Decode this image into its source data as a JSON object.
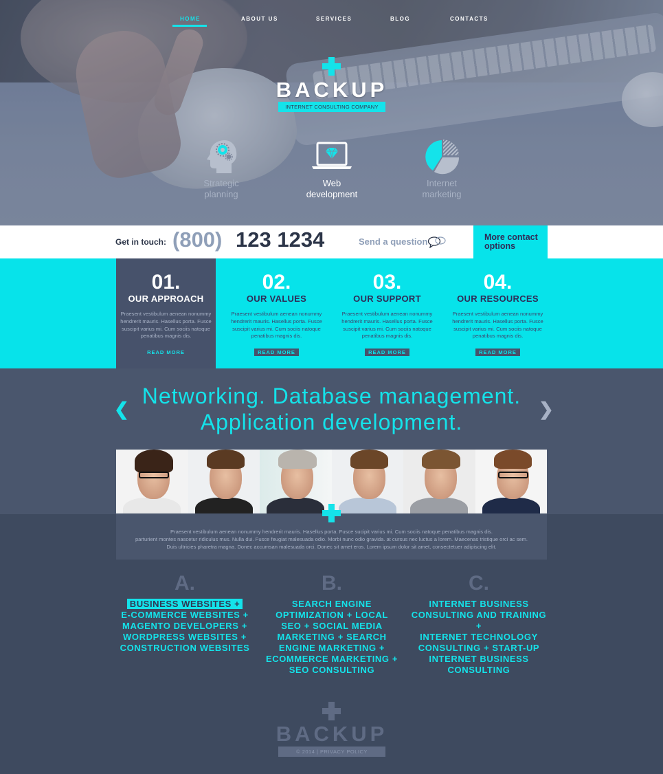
{
  "nav": {
    "items": [
      {
        "label": "HOME",
        "active": true
      },
      {
        "label": "ABOUT US",
        "active": false
      },
      {
        "label": "SERVICES",
        "active": false
      },
      {
        "label": "BLOG",
        "active": false
      },
      {
        "label": "CONTACTS",
        "active": false
      }
    ]
  },
  "brand": {
    "name": "BACKUP",
    "tagline": "INTERNET CONSULTING COMPANY",
    "logo_icon": "plus-icon"
  },
  "hero": {
    "features": [
      {
        "label_line1": "Strategic",
        "label_line2": "planning",
        "icon": "head-gears-icon",
        "active": false
      },
      {
        "label_line1": "Web",
        "label_line2": "development",
        "icon": "laptop-diamond-icon",
        "active": true
      },
      {
        "label_line1": "Internet",
        "label_line2": "marketing",
        "icon": "pie-chart-icon",
        "active": false
      }
    ]
  },
  "contact": {
    "label": "Get in touch:",
    "phone_area": "(800)",
    "phone_number": "123 1234",
    "send_question": "Send a question",
    "send_question_icon": "speech-bubbles-icon",
    "more_contact_line1": "More contact",
    "more_contact_line2": "options"
  },
  "cards": [
    {
      "num": "01.",
      "title": "OUR APPROACH",
      "text": "Praesent vestibulum aenean nonummy hendrerit mauris. Hasellus porta. Fusce suscipit varius mi. Cum sociis natoque penatibus magnis dis.",
      "button": "READ MORE"
    },
    {
      "num": "02.",
      "title": "OUR VALUES",
      "text": "Praesent vestibulum aenean nonummy hendrerit mauris. Hasellus porta. Fusce suscipit varius mi. Cum sociis natoque penatibus magnis dis.",
      "button": "READ MORE"
    },
    {
      "num": "03.",
      "title": "OUR SUPPORT",
      "text": "Praesent vestibulum aenean nonummy hendrerit mauris. Hasellus porta. Fusce suscipit varius mi. Cum sociis natoque penatibus magnis dis.",
      "button": "READ MORE"
    },
    {
      "num": "04.",
      "title": "OUR RESOURCES",
      "text": "Praesent vestibulum aenean nonummy hendrerit mauris. Hasellus porta. Fusce suscipit varius mi. Cum sociis natoque penatibus magnis dis.",
      "button": "READ MORE"
    }
  ],
  "slider": {
    "line1": "Networking. Database management.",
    "line2": "Application development.",
    "prev_icon": "chevron-left-icon",
    "next_icon": "chevron-right-icon",
    "prev_glyph": "❮",
    "next_glyph": "❯"
  },
  "team": {
    "photos": [
      {
        "alt": "man with glasses"
      },
      {
        "alt": "smiling woman"
      },
      {
        "alt": "older man with beard"
      },
      {
        "alt": "young woman"
      },
      {
        "alt": "man in suit"
      },
      {
        "alt": "woman with glasses"
      }
    ]
  },
  "about": {
    "line1": "Praesent vestibulum aenean nonummy hendrerit mauris. Hasellus porta. Fusce sucipit varius mi. Cum sociis natoque penatibus magnis dis.",
    "line2": "parturient montes nascetur ridiculus mus. Nulla dui. Fusce feugiat malesuada odio. Morbi nunc odio gravida. at cursus nec luctus a lorem. Maecenas tristique orci ac sem.",
    "line3": "Duis ultricies pharetra magna. Donec accumsan malesuada orci. Donec sit amet eros. Lorem ipsum dolor sit amet, consectetuer adipiscing elit."
  },
  "services": [
    {
      "letter": "A.",
      "highlight": "BUSINESS WEBSITES +",
      "lines": [
        "E-COMMERCE WEBSITES +",
        "MAGENTO DEVELOPERS +",
        "WORDPRESS WEBSITES +",
        "CONSTRUCTION WEBSITES"
      ]
    },
    {
      "letter": "B.",
      "highlight": "",
      "lines": [
        "SEARCH ENGINE",
        "OPTIMIZATION + LOCAL",
        "SEO + SOCIAL MEDIA",
        "MARKETING + SEARCH",
        "ENGINE MARKETING +",
        "ECOMMERCE MARKETING +",
        "SEO CONSULTING"
      ]
    },
    {
      "letter": "C.",
      "highlight": "",
      "lines": [
        "INTERNET BUSINESS",
        "CONSULTING AND TRAINING +",
        "INTERNET TECHNOLOGY",
        "CONSULTING + START-UP",
        "INTERNET BUSINESS",
        "CONSULTING"
      ]
    }
  ],
  "footer": {
    "brand": "BACKUP",
    "copyright": "© 2014",
    "separator": "|",
    "privacy": "PRIVACY POLICY"
  },
  "colors": {
    "accent": "#14e3ea",
    "dark_slate": "#47526b",
    "navy_text": "#2f2d58",
    "muted": "#5f6b84"
  }
}
